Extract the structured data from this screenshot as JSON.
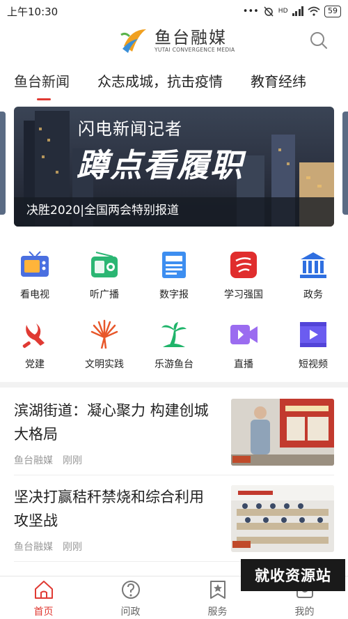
{
  "status_bar": {
    "time": "上午10:30",
    "network": "HD",
    "battery": "59"
  },
  "header": {
    "logo_title": "鱼台融媒",
    "logo_subtitle": "YUTAI CONVERGENCE MEDIA"
  },
  "tabs": [
    {
      "label": "鱼台新闻",
      "active": true
    },
    {
      "label": "众志成城，抗击疫情",
      "active": false
    },
    {
      "label": "教育经纬",
      "active": false
    }
  ],
  "banner": {
    "line1": "闪电新闻记者",
    "line2": "蹲点看履职",
    "line3": "决胜2020|全国两会特别报道"
  },
  "grid": [
    [
      {
        "label": "看电视",
        "icon": "tv-icon",
        "color": "#4a6fe0"
      },
      {
        "label": "听广播",
        "icon": "radio-icon",
        "color": "#2bb673"
      },
      {
        "label": "数字报",
        "icon": "newspaper-icon",
        "color": "#3d8ef0"
      },
      {
        "label": "学习强国",
        "icon": "xuexi-icon",
        "color": "#e02d2d"
      },
      {
        "label": "政务",
        "icon": "government-icon",
        "color": "#2f6fe0"
      }
    ],
    [
      {
        "label": "党建",
        "icon": "party-icon",
        "color": "#e03a33"
      },
      {
        "label": "文明实践",
        "icon": "civilization-icon",
        "color": "#e8572a"
      },
      {
        "label": "乐游鱼台",
        "icon": "palm-tree-icon",
        "color": "#1fb46a"
      },
      {
        "label": "直播",
        "icon": "live-icon",
        "color": "#9b6cf0"
      },
      {
        "label": "短视频",
        "icon": "video-icon",
        "color": "#6b5cf0"
      }
    ]
  ],
  "news": [
    {
      "title": "滨湖街道：凝心聚力 构建创城大格局",
      "source": "鱼台融媒",
      "time": "刚刚"
    },
    {
      "title": "坚决打赢秸秆禁烧和综合利用攻坚战",
      "source": "鱼台融媒",
      "time": "刚刚"
    }
  ],
  "bottom_nav": [
    {
      "label": "首页",
      "icon": "home-icon",
      "active": true
    },
    {
      "label": "问政",
      "icon": "question-icon",
      "active": false
    },
    {
      "label": "服务",
      "icon": "service-icon",
      "active": false
    },
    {
      "label": "我的",
      "icon": "profile-icon",
      "active": false
    }
  ],
  "watermark": "就收资源站"
}
